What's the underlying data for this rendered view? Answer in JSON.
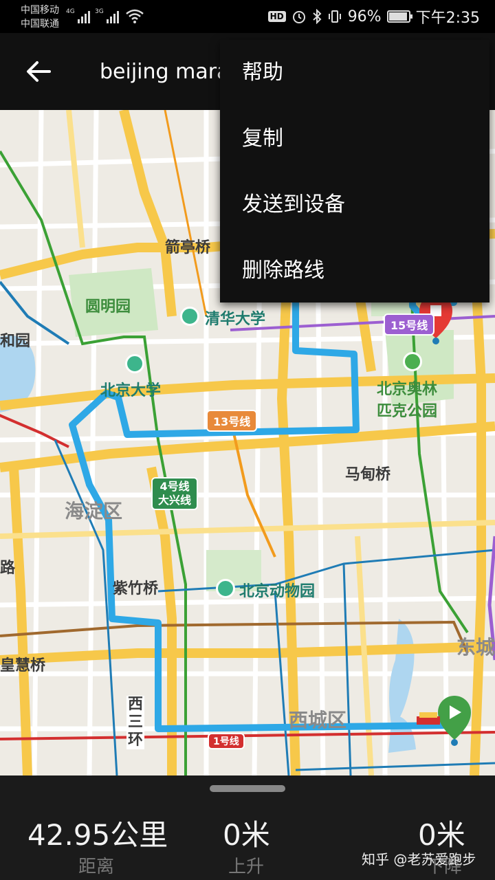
{
  "status_bar": {
    "carrier_1": "中国移动",
    "carrier_2": "中国联通",
    "net_1": "4G",
    "net_2": "3G",
    "hd": "HD",
    "battery": "96%",
    "battery_level": 0.96,
    "time": "下午2:35"
  },
  "header": {
    "title": "beijing mara"
  },
  "menu": {
    "items": [
      "帮助",
      "复制",
      "发送到设备",
      "删除路线"
    ]
  },
  "map": {
    "labels": {
      "jianting": "箭亭桥",
      "yuanming": "圆明园",
      "tsinghua": "清华大学",
      "heyuan": "和园",
      "pku": "北京大学",
      "olympic_1": "北京奥林",
      "olympic_2": "匹克公园",
      "line13": "13号线",
      "line15": "15号线",
      "madian": "马甸桥",
      "line4_1": "4号线",
      "line4_2": "大兴线",
      "haidian": "海淀区",
      "lu": "路",
      "zizhu": "紫竹桥",
      "zoo": "北京动物园",
      "dongcheng": "东城",
      "huilu": "皇慧桥",
      "xisanhuan_1": "西",
      "xisanhuan_2": "三",
      "xisanhuan_3": "环",
      "xicheng": "西城区",
      "line1": "1号线"
    },
    "colors": {
      "route": "#2ea8e6",
      "road_major": "#f7c84a",
      "end_marker": "#e53935",
      "start_marker": "#43a047"
    }
  },
  "stats": {
    "distance_value": "42.95公里",
    "distance_label": "距离",
    "ascent_value": "0米",
    "ascent_label": "上升",
    "descent_value": "0米",
    "descent_label": "下降"
  },
  "watermark": "知乎 @老苏爱跑步"
}
